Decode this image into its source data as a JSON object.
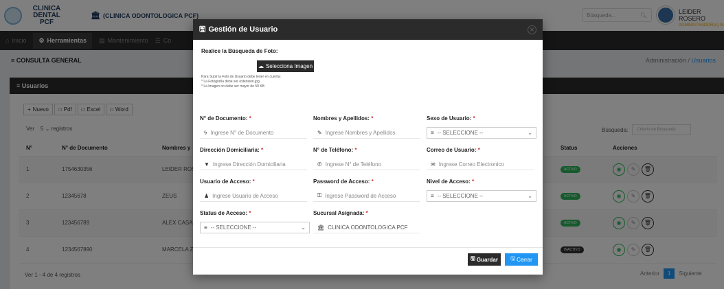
{
  "topbar": {
    "brand": "CLINICA DENTAL PCF",
    "clinic": "(CLINICA ODONTOLOGICA PCF)",
    "search_placeholder": "Búsqueda...",
    "user_name": "LEIDER ROSERO",
    "user_role": "ADMINISTRADOR(A) SUCU..."
  },
  "nav": {
    "items": [
      {
        "label": "Inicio"
      },
      {
        "label": "Herramientas"
      },
      {
        "label": "Mantenimiento"
      },
      {
        "label": "Co"
      }
    ]
  },
  "breadcrumb": {
    "left": "CONSULTA GENERAL",
    "root": "Administración",
    "sep": "/",
    "current": "Usuarios"
  },
  "panel": {
    "title": "Usuarios",
    "buttons": {
      "nuevo": "Nuevo",
      "pdf": "Pdf",
      "excel": "Excel",
      "word": "Word"
    },
    "ver_label": "Ver",
    "ver_value": "5",
    "registros": "registros",
    "busqueda_label": "Búsqueda:",
    "busqueda_placeholder": "Criterio de Búsqueda",
    "headers": {
      "n": "N°",
      "doc": "N° de Documento",
      "nombres": "Nombres y",
      "status": "Status",
      "acciones": "Acciones"
    },
    "rows": [
      {
        "n": "1",
        "doc": "1754630356",
        "nombre": "LEIDER ROS",
        "status": "ACTIVO",
        "active": true
      },
      {
        "n": "2",
        "doc": "12345678",
        "nombre": "ZEUS",
        "status": "ACTIVO",
        "active": true
      },
      {
        "n": "3",
        "doc": "123456789",
        "nombre": "ALEX CASA",
        "status": "ACTIVO",
        "active": true
      },
      {
        "n": "4",
        "doc": "1234567890",
        "nombre": "MARCELA Z",
        "status": "INACTIVO",
        "active": false
      }
    ],
    "footer": "Ver 1 - 4 de 4 registros",
    "pag_prev": "Anterior",
    "pag_page": "1",
    "pag_next": "Siguiente"
  },
  "modal": {
    "title": "Gestión de Usuario",
    "photo_label": "Realice la Búsqueda de Foto:",
    "select_image": "Selecciona Imagen",
    "note1": "Para Subir la Foto de Usuario debe tener en cuenta:",
    "note2": "* La Fotografía debe ser extension.jpg",
    "note3": "* La Imagen no debe ser mayor de 50 KB",
    "fields": {
      "doc_label": "N° de Documento:",
      "doc_ph": "Ingrese N° de Documento",
      "nombres_label": "Nombres y Apellidos:",
      "nombres_ph": "Ingrese Nombres y Apellidos",
      "sexo_label": "Sexo de Usuario:",
      "sexo_value": "-- SELECCIONE --",
      "dir_label": "Dirección Domiciliaria:",
      "dir_ph": "Ingrese Dirección Domiciliaria",
      "tel_label": "N° de Teléfono:",
      "tel_ph": "Ingrese N° de Teléfono",
      "correo_label": "Correo de Usuario:",
      "correo_ph": "Ingrese Correo Electronico",
      "usuario_label": "Usuario de Acceso:",
      "usuario_ph": "Ingrese Usuario de Acceso",
      "pass_label": "Password de Acceso:",
      "pass_ph": "Ingrese Password de Acceso",
      "nivel_label": "Nivel de Acceso:",
      "nivel_value": "-- SELECCIONE --",
      "status_label": "Status de Acceso:",
      "status_value": "-- SELECCIONE --",
      "sucursal_label": "Sucursal Asignada:",
      "sucursal_value": "CLINICA ODONTOLOGICA PCF",
      "required": "*"
    },
    "guardar": "Guardar",
    "cerrar": "Cerrar"
  }
}
